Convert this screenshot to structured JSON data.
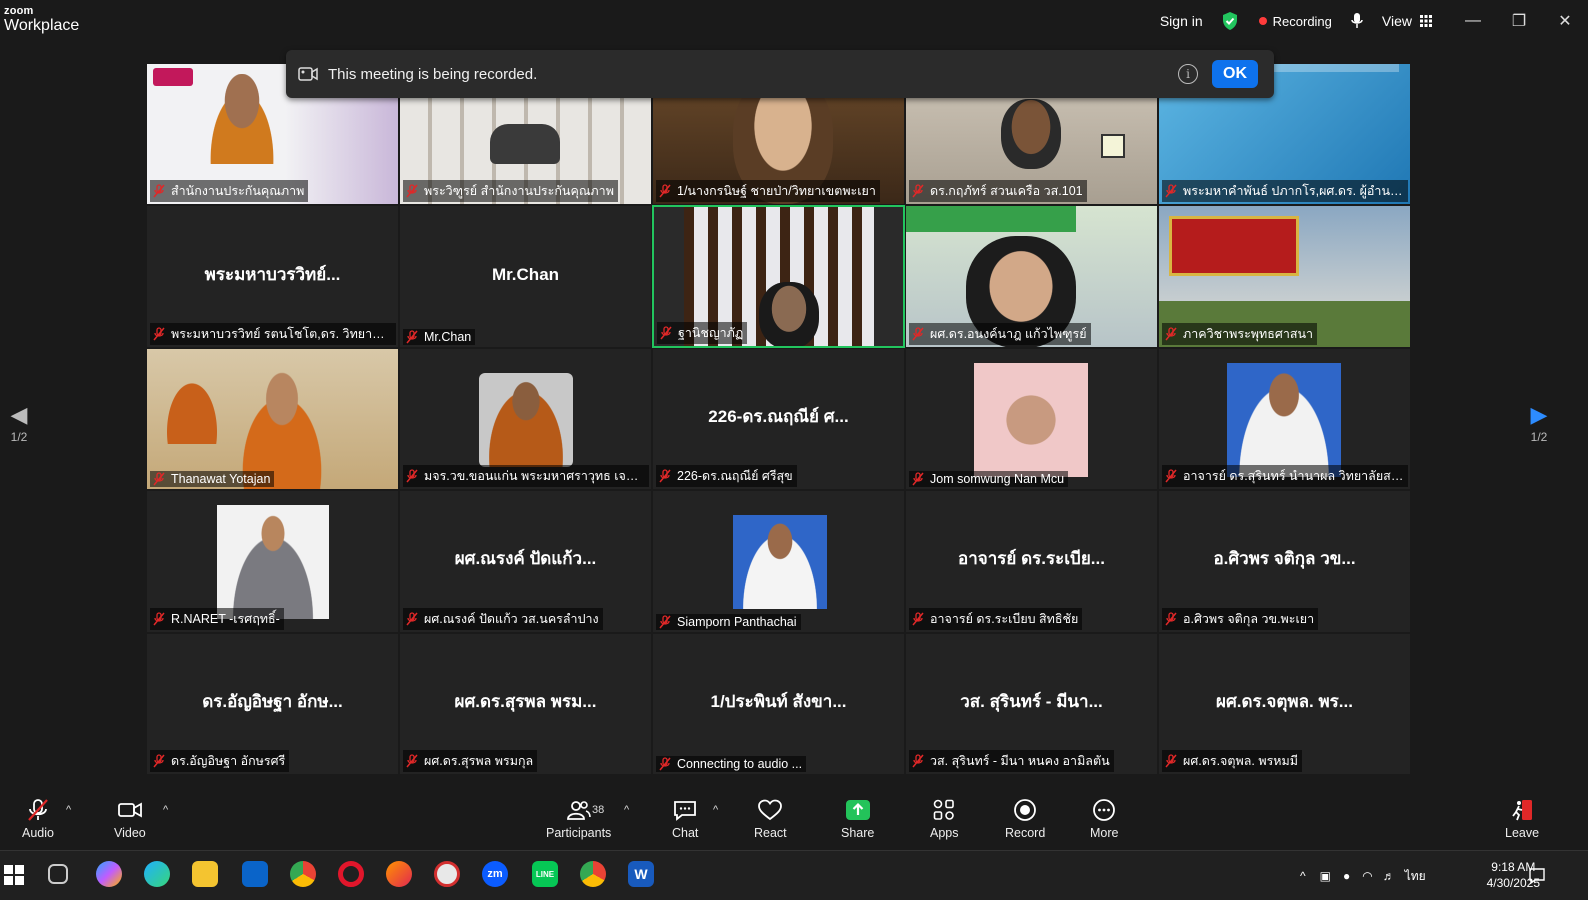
{
  "app": {
    "brand_top": "zoom",
    "brand_bottom": "Workplace"
  },
  "titlebar": {
    "sign_in": "Sign in",
    "recording": "Recording",
    "view": "View"
  },
  "banner": {
    "message": "This meeting is being recorded.",
    "ok": "OK",
    "info": "i"
  },
  "page_indicator": {
    "left": "1/2",
    "right": "1/2"
  },
  "participants": [
    {
      "label": "สำนักงานประกันคุณภาพ",
      "center": "",
      "video": "monk-slide"
    },
    {
      "label": "พระวิฑูรย์ สำนักงานประกันคุณภาพ",
      "center": "",
      "video": "bookshelf"
    },
    {
      "label": "1/นางกรนิษฐ์ ชายป่า/วิทยาเขตพะเยา",
      "center": "",
      "video": "woman-glasses"
    },
    {
      "label": "ดร.กฤภัทร์ สวนเครือ วส.101",
      "center": "",
      "video": "man-room"
    },
    {
      "label": "พระมหาคำพันธ์ ปภากโร,ผศ.ดร. ผู้อำนวยการ...",
      "center": "",
      "video": "slide-blue"
    },
    {
      "label": "พระมหาบวรวิทย์ รตนโชโต,ดร. วิทยาลัยสงฆ์น...",
      "center": "พระมหาบวรวิทย์...",
      "video": ""
    },
    {
      "label": "Mr.Chan",
      "center": "Mr.Chan",
      "video": ""
    },
    {
      "label": "ฐานิชญาภัฏ",
      "center": "",
      "video": "woman-window"
    },
    {
      "label": "ผศ.ดร.อนงค์นาฎ แก้วไพฑูรย์",
      "center": "",
      "video": "woman-screen"
    },
    {
      "label": "ภาควิชาพระพุทธศาสนา",
      "center": "",
      "video": "building"
    },
    {
      "label": "Thanawat Yotajan",
      "center": "",
      "video": "monks-table"
    },
    {
      "label": "มจร.วข.ขอนแก่น พระมหาศราวุทธ เจตรา",
      "center": "",
      "video": "monk-portrait"
    },
    {
      "label": "226-ดร.ณฤณีย์ ศรีสุข",
      "center": "226-ดร.ณฤณีย์ ศ...",
      "video": ""
    },
    {
      "label": "Jom somwung Nan Mcu",
      "center": "",
      "video": "man-pink"
    },
    {
      "label": "อาจารย์ ดร.สุรินทร์ นำนาผล วิทยาลัยสงฆ์เร...",
      "center": "",
      "video": "officer"
    },
    {
      "label": "R.NARET -เรศฤทธิ์-",
      "center": "",
      "video": "man-suit"
    },
    {
      "label": "ผศ.ณรงค์ ปัดแก้ว วส.นครลำปาง",
      "center": "ผศ.ณรงค์ ปัดแก้ว...",
      "video": ""
    },
    {
      "label": "Siamporn Panthachai",
      "center": "",
      "video": "officer2"
    },
    {
      "label": "อาจารย์ ดร.ระเบียบ สิทธิชัย",
      "center": "อาจารย์ ดร.ระเบีย...",
      "video": ""
    },
    {
      "label": "อ.ศิวพร จติกุล วข.พะเยา",
      "center": "อ.ศิวพร จติกุล วข...",
      "video": ""
    },
    {
      "label": "ดร.อัญอิษฐา อักษรศรี",
      "center": "ดร.อัญอิษฐา อักษ...",
      "video": ""
    },
    {
      "label": "ผศ.ดร.สุรพล พรมกุล",
      "center": "ผศ.ดร.สุรพล พรม...",
      "video": ""
    },
    {
      "label": "Connecting to audio ...",
      "center": "1/ประพินท์ สังขา...",
      "video": ""
    },
    {
      "label": "วส. สุรินทร์ - มีนา หนคง อามิลตัน",
      "center": "วส. สุรินทร์ - มีนา...",
      "video": ""
    },
    {
      "label": "ผศ.ดร.จตุพล. พรหมมี",
      "center": "ผศ.ดร.จตุพล. พร...",
      "video": ""
    }
  ],
  "toolbar": {
    "audio": "Audio",
    "video": "Video",
    "participants": "Participants",
    "participants_count": "38",
    "chat": "Chat",
    "react": "React",
    "share": "Share",
    "apps": "Apps",
    "record": "Record",
    "more": "More",
    "leave": "Leave"
  },
  "taskbar": {
    "time": "9:18 AM",
    "date": "4/30/2025",
    "lang": "ไทย",
    "zoom_label": "zm",
    "line_label": "LINE",
    "word_label": "W"
  },
  "colors": {
    "accent": "#0e72ed",
    "active_border": "#22c55e",
    "recording": "#ff3b3b",
    "share": "#23c35a",
    "leave": "#e02828"
  }
}
